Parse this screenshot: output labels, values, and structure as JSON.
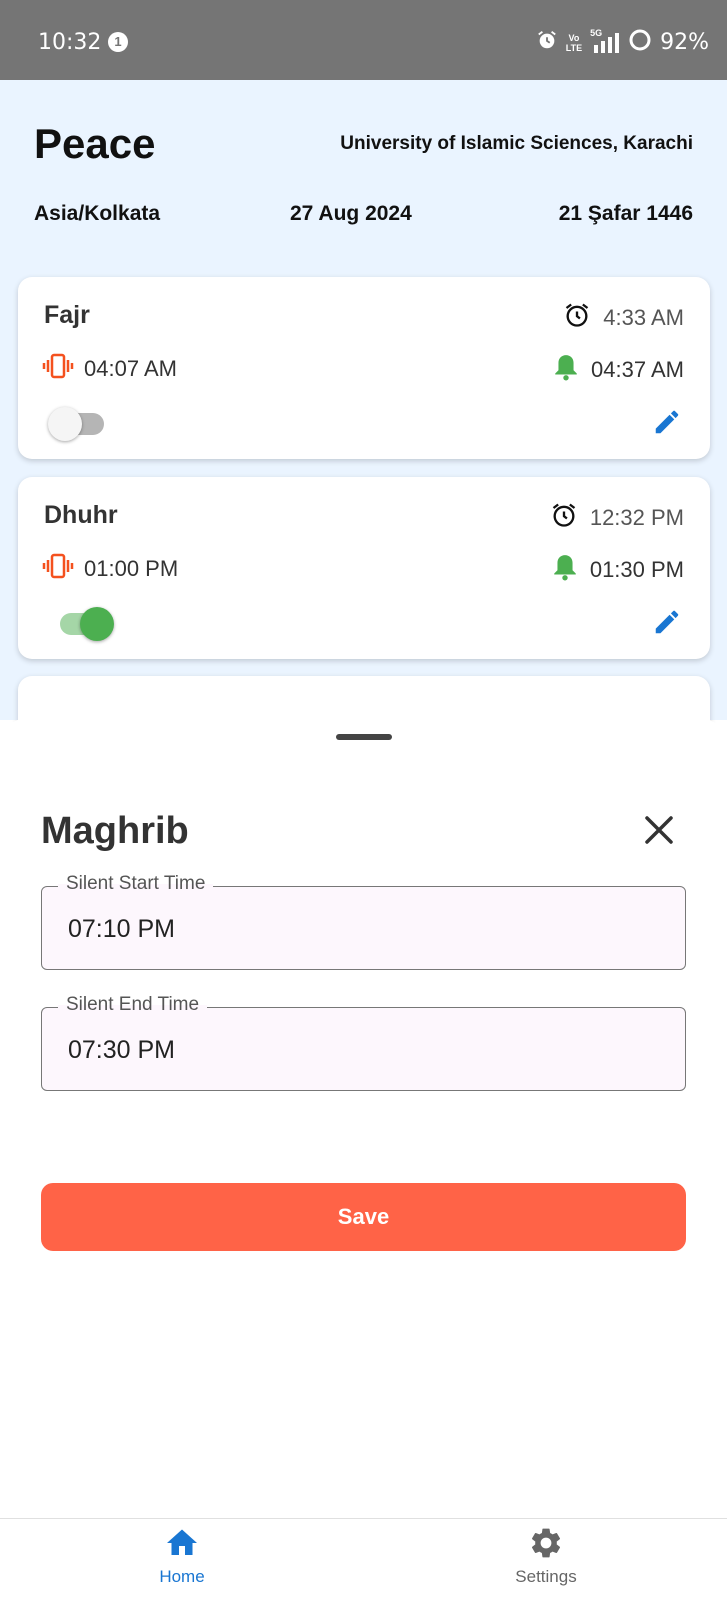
{
  "status_bar": {
    "time": "10:32",
    "notification_count": "1",
    "volte_top": "Vo",
    "volte_bottom": "LTE",
    "network": "5G",
    "battery": "92%"
  },
  "header": {
    "app_name": "Peace",
    "location": "University of Islamic Sciences, Karachi",
    "timezone": "Asia/Kolkata",
    "gregorian_date": "27 Aug 2024",
    "hijri_date": "21 Şafar 1446"
  },
  "prayers": [
    {
      "name": "Fajr",
      "alarm_time": "4:33 AM",
      "silent_start": "04:07 AM",
      "silent_end": "04:37 AM",
      "enabled": false
    },
    {
      "name": "Dhuhr",
      "alarm_time": "12:32 PM",
      "silent_start": "01:00 PM",
      "silent_end": "01:30 PM",
      "enabled": true
    }
  ],
  "sheet": {
    "title": "Maghrib",
    "start_label": "Silent Start Time",
    "start_value": "07:10 PM",
    "end_label": "Silent End Time",
    "end_value": "07:30 PM",
    "save_label": "Save"
  },
  "nav": {
    "home_label": "Home",
    "settings_label": "Settings"
  },
  "colors": {
    "accent": "#1976d2",
    "save": "#ff6347",
    "vibrate_icon": "#f4511e",
    "bell_icon": "#4caf50",
    "toggle_on": "#4caf50",
    "header_bg": "#eaf4ff"
  }
}
